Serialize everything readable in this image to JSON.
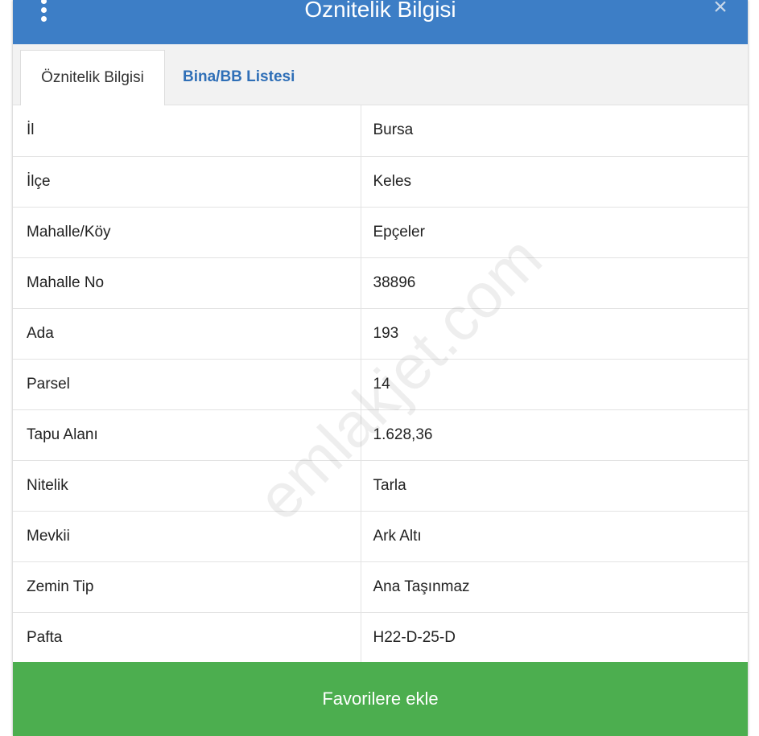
{
  "header": {
    "title": "Öznitelik Bilgisi",
    "menu_icon": "more-vertical-icon",
    "close_icon": "close-icon",
    "close_glyph": "×",
    "background_color": "#3d7ec6"
  },
  "tabs": [
    {
      "label": "Öznitelik Bilgisi",
      "active": true
    },
    {
      "label": "Bina/BB Listesi",
      "active": false
    }
  ],
  "attributes": [
    {
      "label": "İl",
      "value": "Bursa"
    },
    {
      "label": "İlçe",
      "value": "Keles"
    },
    {
      "label": "Mahalle/Köy",
      "value": "Epçeler"
    },
    {
      "label": "Mahalle No",
      "value": "38896"
    },
    {
      "label": "Ada",
      "value": "193"
    },
    {
      "label": "Parsel",
      "value": "14"
    },
    {
      "label": "Tapu Alanı",
      "value": "1.628,36"
    },
    {
      "label": "Nitelik",
      "value": "Tarla"
    },
    {
      "label": "Mevkii",
      "value": "Ark Altı"
    },
    {
      "label": "Zemin Tip",
      "value": "Ana Taşınmaz"
    },
    {
      "label": "Pafta",
      "value": "H22-D-25-D"
    }
  ],
  "footer": {
    "button_label": "Favorilere ekle",
    "button_color": "#4cae4f"
  },
  "watermark": {
    "text": "emlakjet.com"
  }
}
